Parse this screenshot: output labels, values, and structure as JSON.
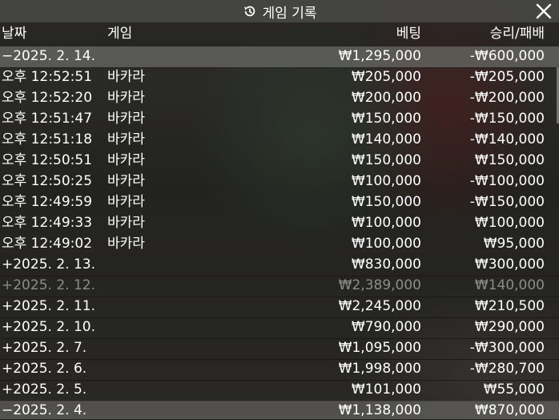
{
  "header": {
    "title": "게임 기록"
  },
  "columns": {
    "date": "날짜",
    "game": "게임",
    "bet": "베팅",
    "winloss": "승리/패배"
  },
  "rows": [
    {
      "date": "−2025. 2. 14.",
      "game": "",
      "bet": "₩1,295,000",
      "winloss": "-₩600,000"
    },
    {
      "date": "오후 12:52:51",
      "game": "바카라",
      "bet": "₩205,000",
      "winloss": "-₩205,000"
    },
    {
      "date": "오후 12:52:20",
      "game": "바카라",
      "bet": "₩200,000",
      "winloss": "-₩200,000"
    },
    {
      "date": "오후 12:51:47",
      "game": "바카라",
      "bet": "₩150,000",
      "winloss": "-₩150,000"
    },
    {
      "date": "오후 12:51:18",
      "game": "바카라",
      "bet": "₩140,000",
      "winloss": "-₩140,000"
    },
    {
      "date": "오후 12:50:51",
      "game": "바카라",
      "bet": "₩150,000",
      "winloss": "₩150,000"
    },
    {
      "date": "오후 12:50:25",
      "game": "바카라",
      "bet": "₩100,000",
      "winloss": "-₩100,000"
    },
    {
      "date": "오후 12:49:59",
      "game": "바카라",
      "bet": "₩150,000",
      "winloss": "-₩150,000"
    },
    {
      "date": "오후 12:49:33",
      "game": "바카라",
      "bet": "₩100,000",
      "winloss": "₩100,000"
    },
    {
      "date": "오후 12:49:02",
      "game": "바카라",
      "bet": "₩100,000",
      "winloss": "₩95,000"
    },
    {
      "date": "+2025. 2. 13.",
      "game": "",
      "bet": "₩830,000",
      "winloss": "₩300,000"
    },
    {
      "date": "+2025. 2. 12.",
      "game": "",
      "bet": "₩2,389,000",
      "winloss": "₩140,000"
    },
    {
      "date": "+2025. 2. 11.",
      "game": "",
      "bet": "₩2,245,000",
      "winloss": "₩210,500"
    },
    {
      "date": "+2025. 2. 10.",
      "game": "",
      "bet": "₩790,000",
      "winloss": "₩290,000"
    },
    {
      "date": "+2025. 2. 7.",
      "game": "",
      "bet": "₩1,095,000",
      "winloss": "-₩300,000"
    },
    {
      "date": "+2025. 2. 6.",
      "game": "",
      "bet": "₩1,998,000",
      "winloss": "-₩280,700"
    },
    {
      "date": "+2025. 2. 5.",
      "game": "",
      "bet": "₩101,000",
      "winloss": "₩55,000"
    },
    {
      "date": "−2025. 2. 4.",
      "game": "",
      "bet": "₩1,138,000",
      "winloss": "₩870,000"
    }
  ]
}
